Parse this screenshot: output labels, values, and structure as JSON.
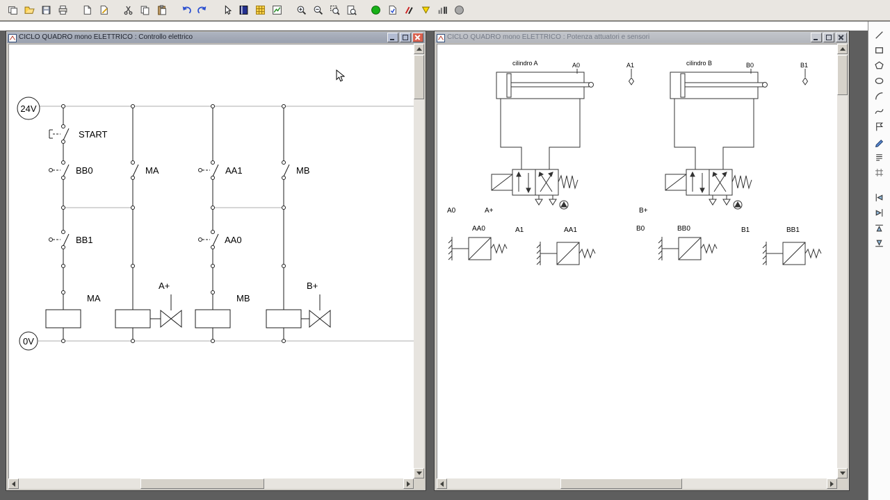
{
  "colors": {
    "sim_green": "#17b117",
    "sim_stop_gray": "#a8a8a8",
    "close_red": "#d9604e",
    "rail_gray": "#adadad"
  },
  "toolbar": {
    "icons": [
      {
        "name": "new-window",
        "group": 1
      },
      {
        "name": "open",
        "group": 1
      },
      {
        "name": "save",
        "group": 1
      },
      {
        "name": "print",
        "group": 1
      },
      {
        "name": "new-page",
        "group": 2
      },
      {
        "name": "edit-page",
        "group": 2
      },
      {
        "name": "cut",
        "group": 3
      },
      {
        "name": "copy",
        "group": 3
      },
      {
        "name": "paste",
        "group": 3
      },
      {
        "name": "undo",
        "group": 4
      },
      {
        "name": "redo",
        "group": 4
      },
      {
        "name": "select-pointer",
        "group": 5
      },
      {
        "name": "component-library",
        "group": 5
      },
      {
        "name": "grid",
        "group": 5
      },
      {
        "name": "diagram-check",
        "group": 5
      },
      {
        "name": "zoom-in",
        "group": 6
      },
      {
        "name": "zoom-out",
        "group": 6
      },
      {
        "name": "zoom-window",
        "group": 6
      },
      {
        "name": "zoom-page",
        "group": 6
      },
      {
        "name": "simulation-start",
        "group": 7
      },
      {
        "name": "simulation-doc",
        "group": 7
      },
      {
        "name": "simulation-sketch",
        "group": 7
      },
      {
        "name": "simulation-pause",
        "group": 7
      },
      {
        "name": "simulation-diagram",
        "group": 7
      },
      {
        "name": "simulation-stop",
        "group": 7
      }
    ]
  },
  "right_toolbar": {
    "icons": [
      {
        "name": "draw-line",
        "group": 1
      },
      {
        "name": "draw-rectangle",
        "group": 1
      },
      {
        "name": "draw-polygon",
        "group": 1
      },
      {
        "name": "draw-ellipse",
        "group": 1
      },
      {
        "name": "draw-arc",
        "group": 1
      },
      {
        "name": "draw-curve",
        "group": 1
      },
      {
        "name": "draw-flag",
        "group": 1
      },
      {
        "name": "draw-pen",
        "group": 1
      },
      {
        "name": "text-list",
        "group": 1
      },
      {
        "name": "grid-small",
        "group": 1
      },
      {
        "name": "align-left",
        "group": 2
      },
      {
        "name": "align-right",
        "group": 2
      },
      {
        "name": "align-top",
        "group": 2
      },
      {
        "name": "align-bottom",
        "group": 2
      }
    ]
  },
  "left_window": {
    "title": "CICLO QUADRO mono  ELETTRICO : Controllo elettrico",
    "diagram": {
      "rail_top": "24V",
      "rail_bottom": "0V",
      "start": "START",
      "bb0": "BB0",
      "ma_contact": "MA",
      "aa1": "AA1",
      "mb_contact": "MB",
      "bb1": "BB1",
      "aa0": "AA0",
      "ma_coil": "MA",
      "a_plus": "A+",
      "mb_coil": "MB",
      "b_plus": "B+"
    }
  },
  "right_window": {
    "title": "CICLO QUADRO mono  ELETTRICO : Potenza attuatori e sensori",
    "diagram": {
      "cyl_a_label": "cilindro A",
      "a0_mark": "A0",
      "a1_mark": "A1",
      "cyl_b_label": "cilindro B",
      "b0_mark": "B0",
      "b1_mark": "B1",
      "s_a0": "A0",
      "s_a_plus": "A+",
      "s_aa0": "AA0",
      "s_a1": "A1",
      "s_aa1": "AA1",
      "s_b_plus": "B+",
      "s_b0": "B0",
      "s_bb0": "BB0",
      "s_b1": "B1",
      "s_bb1": "BB1"
    }
  }
}
